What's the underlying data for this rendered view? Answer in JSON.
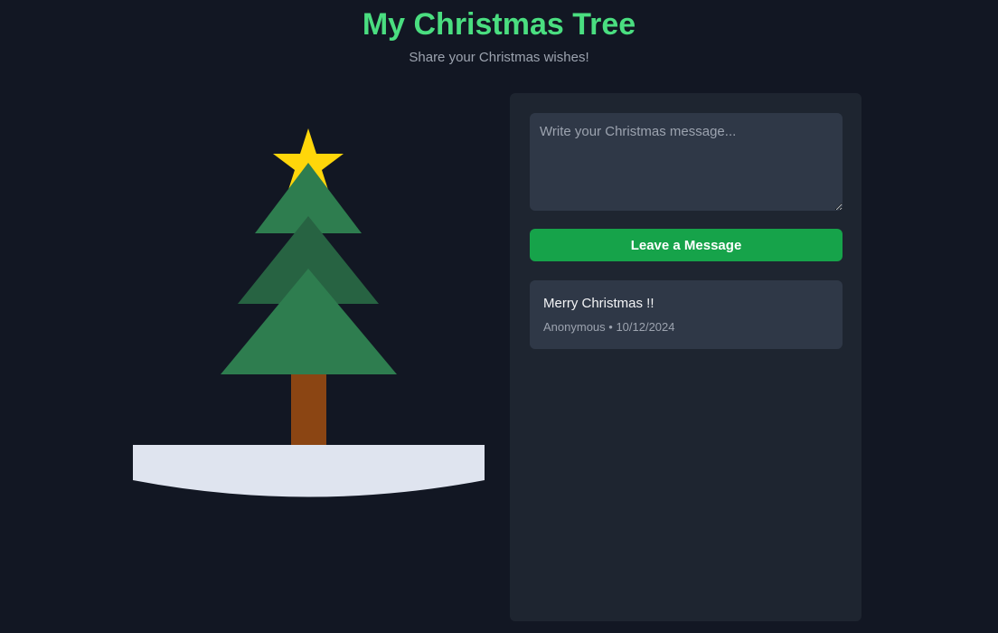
{
  "header": {
    "title": "My Christmas Tree",
    "subtitle": "Share your Christmas wishes!"
  },
  "tree": {
    "star_icon": "star-icon",
    "colors": {
      "star": "#ffd60a",
      "top_tier": "#2e7d4f",
      "middle_tier": "#276342",
      "bottom_tier": "#2e7d4f",
      "trunk": "#8b4513",
      "snow": "#dfe4ef"
    }
  },
  "form": {
    "placeholder": "Write your Christmas message...",
    "value": "",
    "submit_label": "Leave a Message"
  },
  "messages": [
    {
      "text": "Merry Christmas !!",
      "author": "Anonymous",
      "date": "10/12/2024"
    }
  ],
  "colors": {
    "background": "#121723",
    "accent": "#4ade80",
    "button": "#16a34a",
    "panel": "#1e2530",
    "card": "#2f3847"
  }
}
